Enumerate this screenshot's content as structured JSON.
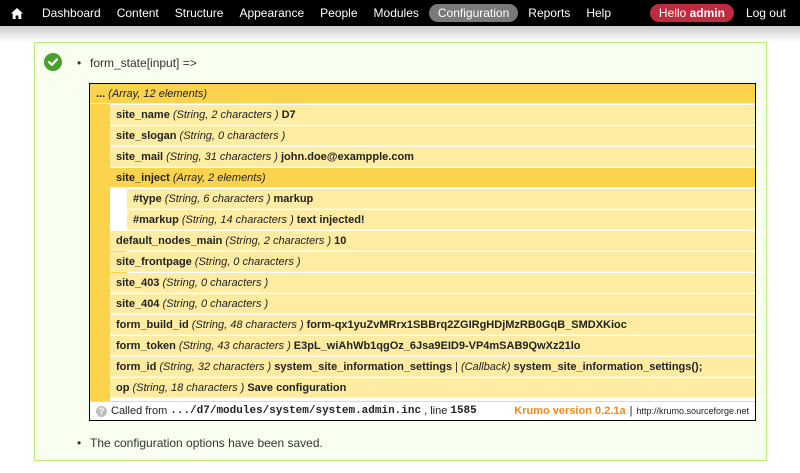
{
  "toolbar": {
    "items": [
      {
        "label": "Dashboard"
      },
      {
        "label": "Content"
      },
      {
        "label": "Structure"
      },
      {
        "label": "Appearance"
      },
      {
        "label": "People"
      },
      {
        "label": "Modules"
      },
      {
        "label": "Configuration"
      },
      {
        "label": "Reports"
      },
      {
        "label": "Help"
      }
    ],
    "active": "Configuration",
    "hello_prefix": "Hello",
    "hello_user": "admin",
    "logout": "Log out"
  },
  "message": {
    "first_bullet": "form_state[input] =>",
    "last_bullet": "The configuration options have been saved."
  },
  "krumo": {
    "root": {
      "key": "...",
      "type": "(Array, 12 elements)"
    },
    "rows": [
      {
        "key": "site_name",
        "type": "(String, 2 characters )",
        "value": "D7"
      },
      {
        "key": "site_slogan",
        "type": "(String, 0 characters )",
        "value": ""
      },
      {
        "key": "site_mail",
        "type": "(String, 31 characters )",
        "value": "john.doe@exampple.com"
      },
      {
        "key": "site_inject",
        "type": "(Array, 2 elements)",
        "value": ""
      },
      {
        "key": "#type",
        "type": "(String, 6 characters )",
        "value": "markup"
      },
      {
        "key": "#markup",
        "type": "(String, 14 characters )",
        "value": "text injected!"
      },
      {
        "key": "default_nodes_main",
        "type": "(String, 2 characters )",
        "value": "10"
      },
      {
        "key": "site_frontpage",
        "type": "(String, 0 characters )",
        "value": ""
      },
      {
        "key": "site_403",
        "type": "(String, 0 characters )",
        "value": ""
      },
      {
        "key": "site_404",
        "type": "(String, 0 characters )",
        "value": ""
      },
      {
        "key": "form_build_id",
        "type": "(String, 48 characters )",
        "value": "form-qx1yuZvMRrx1SBBrq2ZGIRgHDjMzRB0GqB_SMDXKioc"
      },
      {
        "key": "form_token",
        "type": "(String, 43 characters )",
        "value": "E3pL_wiAhWb1qgOz_6Jsa9EID9-VP4mSAB9QwXz21lo"
      },
      {
        "key": "form_id",
        "type": "(String, 32 characters )",
        "value": "system_site_information_settings",
        "sep": "|",
        "callback_type": "(Callback)",
        "callback": "system_site_information_settings();"
      },
      {
        "key": "op",
        "type": "(String, 18 characters )",
        "value": "Save configuration"
      }
    ],
    "footer": {
      "called_from": "Called from",
      "path": ".../d7/modules/system/system.admin.inc",
      "line_label": ", line",
      "line": "1585",
      "version": "Krumo version 0.2.1a",
      "sep": "|",
      "site": "http://krumo.sourceforge.net"
    }
  },
  "colors": {
    "toolbar": "#000000",
    "hello_badge": "#bf2a3e",
    "krumo_expanded": "#fcd34d",
    "krumo_row": "#fdeca2",
    "status_bg": "#f8fff0",
    "krumo_version": "#f08a1f"
  }
}
